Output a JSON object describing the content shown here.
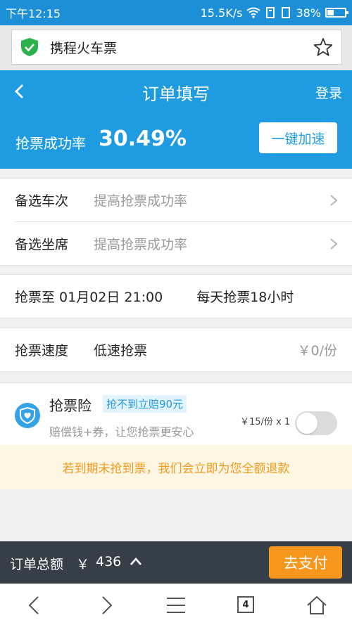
{
  "status_bar": {
    "time": "下午12:15",
    "speed": "15.5K/s",
    "battery": "38%"
  },
  "address_bar": {
    "title": "携程火车票"
  },
  "header": {
    "title": "订单填写",
    "login": "登录",
    "rate_label": "抢票成功率",
    "rate_value": "30.49%",
    "speed_button": "一键加速"
  },
  "options": [
    {
      "label": "备选车次",
      "hint": "提高抢票成功率"
    },
    {
      "label": "备选坐席",
      "hint": "提高抢票成功率"
    }
  ],
  "grab": {
    "date": "抢票至 01月02日 21:00",
    "hours": "每天抢票18小时"
  },
  "speed": {
    "label": "抢票速度",
    "value": "低速抢票",
    "price": "￥0/份"
  },
  "insurance": {
    "title": "抢票险",
    "tag": "抢不到立赔90元",
    "desc": "赔偿钱+券，让您抢票更安心",
    "price": "￥15/份 x 1",
    "enabled": false
  },
  "notice": "若到期未抢到票，我们会立即为您全额退款",
  "paybar": {
    "total_label": "订单总额",
    "currency": "￥",
    "total": "436",
    "pay_button": "去支付"
  },
  "navbar": {
    "tab_count": "4"
  },
  "colors": {
    "primary": "#1f9be2",
    "pay": "#f7961d",
    "notice_text": "#f39a1e",
    "paybar_bg": "#363e48"
  }
}
